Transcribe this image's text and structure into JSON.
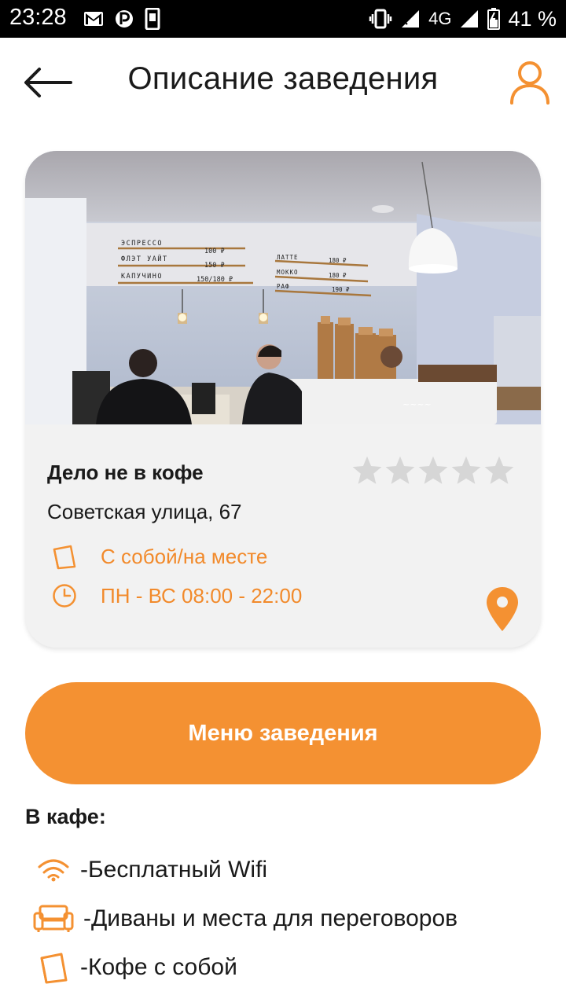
{
  "status_bar": {
    "time": "23:28",
    "network": "4G",
    "battery": "41 %"
  },
  "header": {
    "title": "Описание заведения"
  },
  "venue": {
    "name": "Дело не в кофе",
    "address": "Советская улица, 67",
    "service_type": "С собой/на месте",
    "hours": "ПН - ВС 08:00 - 22:00",
    "rating": 0,
    "rating_max": 5
  },
  "photo_menu_board": {
    "left_items": [
      {
        "name": "ЭСПРЕССО",
        "price": "100 ₽"
      },
      {
        "name": "ФЛЭТ УАЙТ",
        "price": "150 ₽"
      },
      {
        "name": "КАПУЧИНО",
        "price": "150/180 ₽"
      }
    ],
    "right_items": [
      {
        "name": "ЛАТТЕ",
        "price": "180 ₽"
      },
      {
        "name": "МОККО",
        "price": "180 ₽"
      },
      {
        "name": "РАФ",
        "price": "190 ₽"
      }
    ]
  },
  "menu_button": {
    "label": "Меню заведения"
  },
  "amenities": {
    "title": "В кафе:",
    "items": [
      {
        "icon": "wifi-icon",
        "label": "-Бесплатный Wifi"
      },
      {
        "icon": "sofa-icon",
        "label": "-Диваны и места для переговоров"
      },
      {
        "icon": "takeaway-cup-icon",
        "label": "-Кофе с собой"
      }
    ]
  },
  "colors": {
    "accent": "#f49132",
    "accent_text": "#f28a2b",
    "star_empty": "#d6d6d6",
    "card_bg": "#f2f2f2",
    "status_bar": "#000000"
  }
}
